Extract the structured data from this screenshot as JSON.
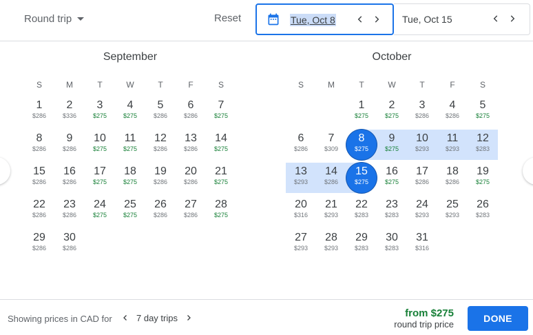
{
  "header": {
    "trip_type": "Round trip",
    "reset_label": "Reset",
    "departure_date": "Tue, Oct 8",
    "return_date": "Tue, Oct 15"
  },
  "days_of_week": [
    "S",
    "M",
    "T",
    "W",
    "T",
    "F",
    "S"
  ],
  "months": [
    {
      "title": "September",
      "first_weekday": 0,
      "days": [
        {
          "day": "1",
          "price": "$286",
          "low": false
        },
        {
          "day": "2",
          "price": "$336",
          "low": false
        },
        {
          "day": "3",
          "price": "$275",
          "low": true
        },
        {
          "day": "4",
          "price": "$275",
          "low": true
        },
        {
          "day": "5",
          "price": "$286",
          "low": false
        },
        {
          "day": "6",
          "price": "$286",
          "low": false
        },
        {
          "day": "7",
          "price": "$275",
          "low": true
        },
        {
          "day": "8",
          "price": "$286",
          "low": false
        },
        {
          "day": "9",
          "price": "$286",
          "low": false
        },
        {
          "day": "10",
          "price": "$275",
          "low": true
        },
        {
          "day": "11",
          "price": "$275",
          "low": true
        },
        {
          "day": "12",
          "price": "$286",
          "low": false
        },
        {
          "day": "13",
          "price": "$286",
          "low": false
        },
        {
          "day": "14",
          "price": "$275",
          "low": true
        },
        {
          "day": "15",
          "price": "$286",
          "low": false
        },
        {
          "day": "16",
          "price": "$286",
          "low": false
        },
        {
          "day": "17",
          "price": "$275",
          "low": true
        },
        {
          "day": "18",
          "price": "$275",
          "low": true
        },
        {
          "day": "19",
          "price": "$286",
          "low": false
        },
        {
          "day": "20",
          "price": "$286",
          "low": false
        },
        {
          "day": "21",
          "price": "$275",
          "low": true
        },
        {
          "day": "22",
          "price": "$286",
          "low": false
        },
        {
          "day": "23",
          "price": "$286",
          "low": false
        },
        {
          "day": "24",
          "price": "$275",
          "low": true
        },
        {
          "day": "25",
          "price": "$275",
          "low": true
        },
        {
          "day": "26",
          "price": "$286",
          "low": false
        },
        {
          "day": "27",
          "price": "$286",
          "low": false
        },
        {
          "day": "28",
          "price": "$275",
          "low": true
        },
        {
          "day": "29",
          "price": "$286",
          "low": false
        },
        {
          "day": "30",
          "price": "$286",
          "low": false
        }
      ]
    },
    {
      "title": "October",
      "first_weekday": 2,
      "days": [
        {
          "day": "1",
          "price": "$275",
          "low": true
        },
        {
          "day": "2",
          "price": "$275",
          "low": true
        },
        {
          "day": "3",
          "price": "$286",
          "low": false
        },
        {
          "day": "4",
          "price": "$286",
          "low": false
        },
        {
          "day": "5",
          "price": "$275",
          "low": true
        },
        {
          "day": "6",
          "price": "$286",
          "low": false
        },
        {
          "day": "7",
          "price": "$309",
          "low": false
        },
        {
          "day": "8",
          "price": "$275",
          "low": true,
          "selected": true
        },
        {
          "day": "9",
          "price": "$275",
          "low": true,
          "range": true
        },
        {
          "day": "10",
          "price": "$293",
          "low": false,
          "range": true
        },
        {
          "day": "11",
          "price": "$293",
          "low": false,
          "range": true
        },
        {
          "day": "12",
          "price": "$283",
          "low": false,
          "range": true
        },
        {
          "day": "13",
          "price": "$293",
          "low": false,
          "range": true
        },
        {
          "day": "14",
          "price": "$286",
          "low": false,
          "range": true
        },
        {
          "day": "15",
          "price": "$275",
          "low": true,
          "selected": true
        },
        {
          "day": "16",
          "price": "$275",
          "low": true
        },
        {
          "day": "17",
          "price": "$286",
          "low": false
        },
        {
          "day": "18",
          "price": "$286",
          "low": false
        },
        {
          "day": "19",
          "price": "$275",
          "low": true
        },
        {
          "day": "20",
          "price": "$316",
          "low": false
        },
        {
          "day": "21",
          "price": "$293",
          "low": false
        },
        {
          "day": "22",
          "price": "$283",
          "low": false
        },
        {
          "day": "23",
          "price": "$283",
          "low": false
        },
        {
          "day": "24",
          "price": "$293",
          "low": false
        },
        {
          "day": "25",
          "price": "$293",
          "low": false
        },
        {
          "day": "26",
          "price": "$283",
          "low": false
        },
        {
          "day": "27",
          "price": "$293",
          "low": false
        },
        {
          "day": "28",
          "price": "$293",
          "low": false
        },
        {
          "day": "29",
          "price": "$283",
          "low": false
        },
        {
          "day": "30",
          "price": "$283",
          "low": false
        },
        {
          "day": "31",
          "price": "$316",
          "low": false
        }
      ]
    }
  ],
  "footer": {
    "showing_text": "Showing prices in CAD for",
    "trip_length": "7 day trips",
    "from_price": "from $275",
    "from_sub": "round trip price",
    "done_label": "DONE"
  },
  "colors": {
    "accent": "#1a73e8",
    "low_price": "#188038",
    "range_highlight": "#d2e3fc"
  }
}
